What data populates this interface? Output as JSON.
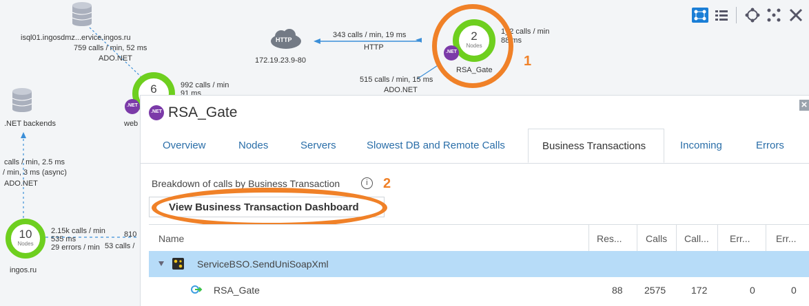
{
  "toolbar": {
    "icons": [
      "flow-map-icon",
      "list-icon",
      "layout-circle-icon",
      "layout-grid-icon",
      "expand-icon"
    ]
  },
  "flowmap": {
    "db_node": {
      "name": "isql01.ingosdmz...ervice.ingos.ru",
      "calls": "759 calls / min, 52 ms",
      "protocol": "ADO.NET"
    },
    "http_node": {
      "badge": "HTTP",
      "address": "172.19.23.9-80",
      "calls": "343 calls / min, 19 ms",
      "protocol": "HTTP"
    },
    "rsa_node": {
      "count": "2",
      "sub": "Nodes",
      "net": ".NET",
      "name": "RSA_Gate",
      "calls_a": "1_2 calls / min",
      "calls_b": "88 ms"
    },
    "rsa_out": {
      "calls": "515 calls / min, 15 ms",
      "protocol": "ADO.NET"
    },
    "web_node": {
      "count": "6",
      "net": ".NET",
      "name": "web",
      "calls_a": "992 calls / min",
      "calls_b": "91 ms"
    },
    "backends": {
      "name": ".NET backends",
      "calls_a": "calls / min, 2.5 ms",
      "calls_b": "/ min, 3 ms (async)",
      "protocol": "ADO.NET"
    },
    "ingos_node": {
      "count": "10",
      "sub": "Nodes",
      "name": "ingos.ru",
      "calls": "2.15k calls / min",
      "ms": "535 ms",
      "errors": "29 errors / min",
      "right_a": "810",
      "right_b": "53 calls /"
    }
  },
  "annotations": {
    "one": "1",
    "two": "2"
  },
  "panel": {
    "net": ".NET",
    "title": "RSA_Gate",
    "close": "×",
    "tabs": [
      "Overview",
      "Nodes",
      "Servers",
      "Slowest DB and Remote Calls",
      "Business Transactions",
      "Incoming",
      "Errors"
    ],
    "breakdown": "Breakdown of calls by Business Transaction",
    "info": "i",
    "dashboard_button": "View Business Transaction Dashboard",
    "columns": [
      "Name",
      "Res...",
      "Calls",
      "Call...",
      "Err...",
      "Err..."
    ],
    "rows": [
      {
        "name": "ServiceBSO.SendUniSoapXml",
        "selected": true
      },
      {
        "name": "RSA_Gate",
        "res": "88",
        "calls": "2575",
        "callmin": "172",
        "err1": "0",
        "err2": "0"
      }
    ]
  },
  "colors": {
    "accent": "#2a6ea8",
    "ring": "#6ecf1f",
    "net": "#7b3aa8",
    "selected_row": "#b7dcf8",
    "annotation": "#f08128"
  }
}
